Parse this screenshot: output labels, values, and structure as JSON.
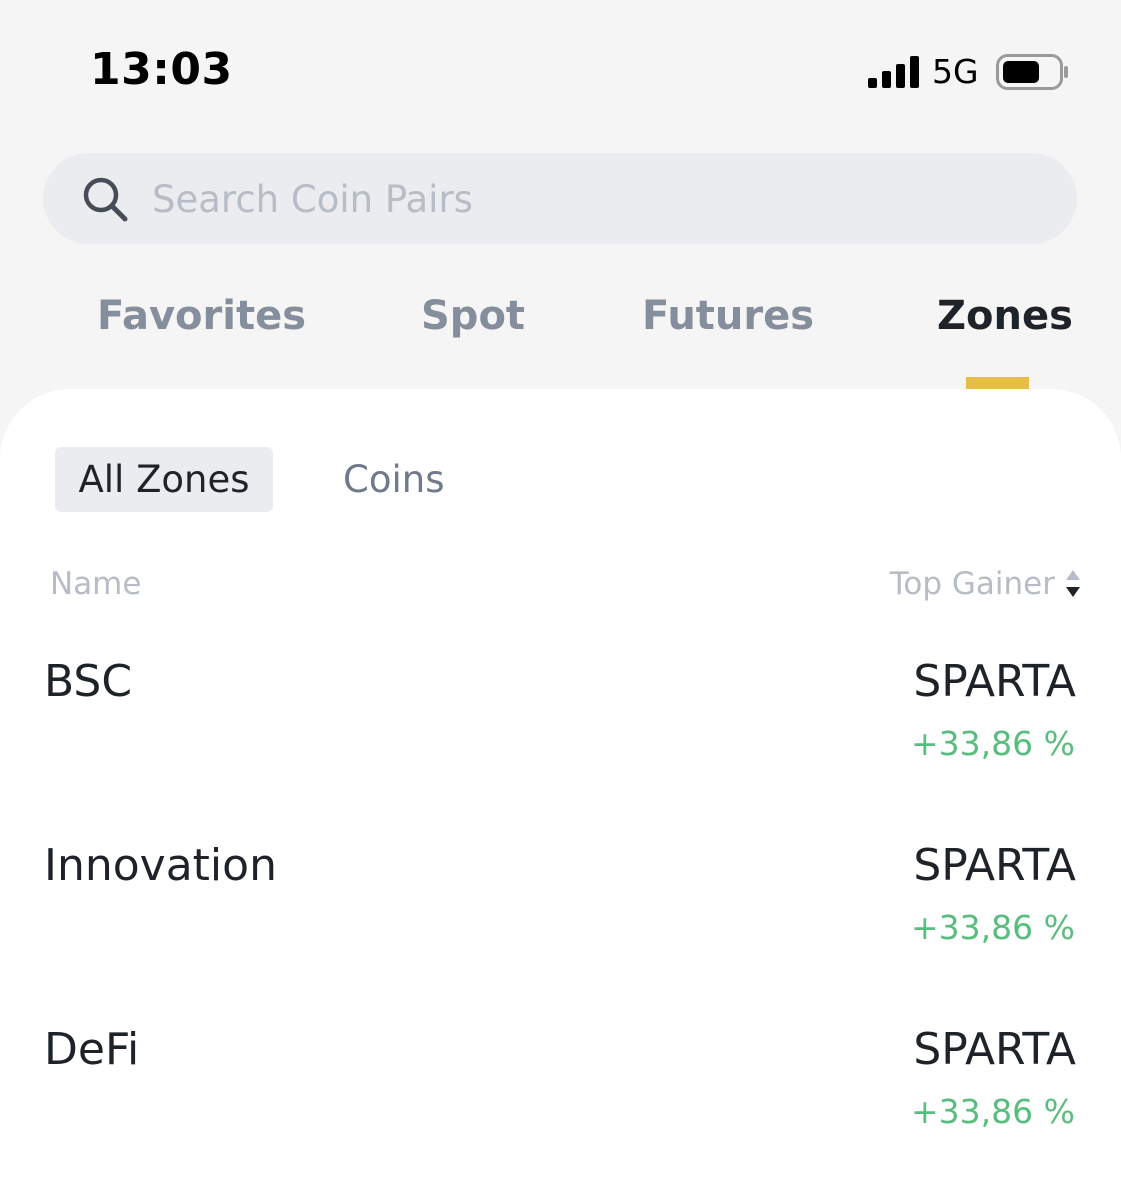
{
  "status_bar": {
    "time": "13:03",
    "network": "5G"
  },
  "search": {
    "placeholder": "Search Coin Pairs"
  },
  "tabs": [
    {
      "label": "Favorites",
      "active": false
    },
    {
      "label": "Spot",
      "active": false
    },
    {
      "label": "Futures",
      "active": false
    },
    {
      "label": "Zones",
      "active": true
    }
  ],
  "subtabs": [
    {
      "label": "All Zones",
      "active": true
    },
    {
      "label": "Coins",
      "active": false
    }
  ],
  "columns": {
    "name": "Name",
    "top_gainer": "Top Gainer"
  },
  "rows": [
    {
      "name": "BSC",
      "coin": "SPARTA",
      "change": "+33,86 %"
    },
    {
      "name": "Innovation",
      "coin": "SPARTA",
      "change": "+33,86 %"
    },
    {
      "name": "DeFi",
      "coin": "SPARTA",
      "change": "+33,86 %"
    }
  ],
  "colors": {
    "accent": "#e7bf47",
    "positive": "#58bd7d",
    "text_primary": "#1e2329",
    "text_secondary": "#848e9c"
  },
  "icons": {
    "signal": "signal-bars-icon",
    "battery": "battery-icon",
    "search": "search-icon",
    "sort": "sort-icon"
  }
}
